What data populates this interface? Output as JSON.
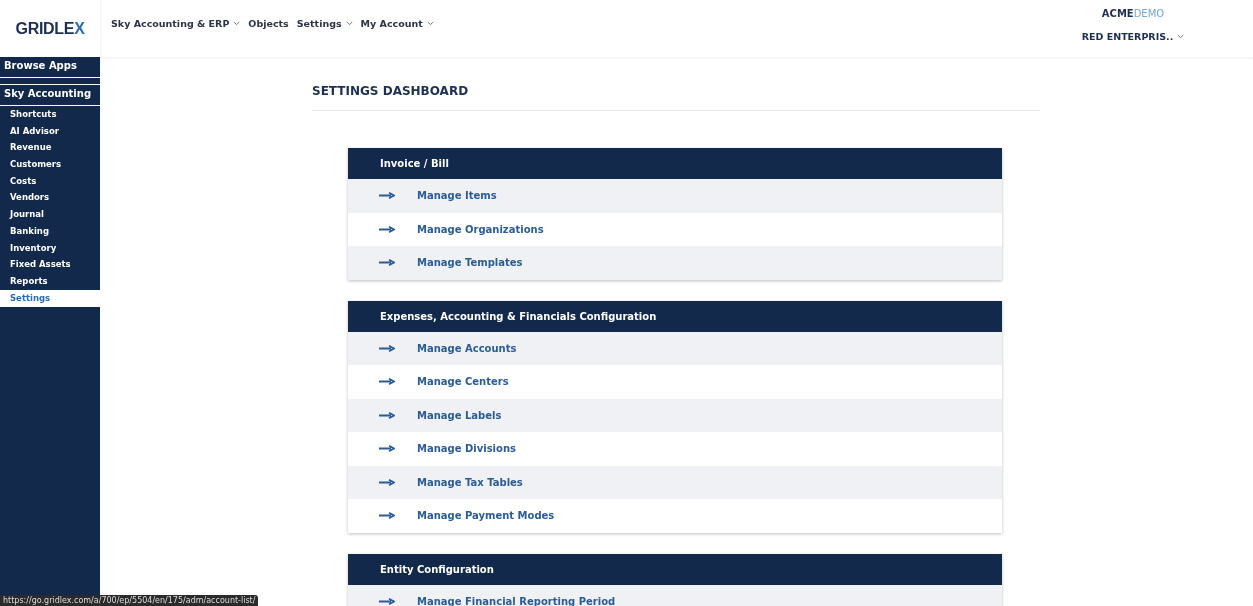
{
  "logo": {
    "main": "GRIDLE",
    "accent": "X"
  },
  "nav": [
    {
      "label": "Sky Accounting & ERP",
      "dropdown": true
    },
    {
      "label": "Objects",
      "dropdown": false
    },
    {
      "label": "Settings",
      "dropdown": true
    },
    {
      "label": "My Account",
      "dropdown": true
    }
  ],
  "brand": {
    "main": "ACME",
    "accent": "DEMO"
  },
  "company": {
    "label": "RED ENTERPRIS..",
    "dropdown": true
  },
  "sidebar": {
    "items": [
      {
        "label": "Browse Apps",
        "kind": "section",
        "selected": false
      },
      {
        "label": "Sky Accounting",
        "kind": "section",
        "selected": false
      },
      {
        "label": "Shortcuts",
        "kind": "item",
        "selected": false
      },
      {
        "label": "AI Advisor",
        "kind": "item",
        "selected": false
      },
      {
        "label": "Revenue",
        "kind": "item",
        "selected": false
      },
      {
        "label": "Customers",
        "kind": "item",
        "selected": false
      },
      {
        "label": "Costs",
        "kind": "item",
        "selected": false
      },
      {
        "label": "Vendors",
        "kind": "item",
        "selected": false
      },
      {
        "label": "Journal",
        "kind": "item",
        "selected": false
      },
      {
        "label": "Banking",
        "kind": "item",
        "selected": false
      },
      {
        "label": "Inventory",
        "kind": "item",
        "selected": false
      },
      {
        "label": "Fixed Assets",
        "kind": "item",
        "selected": false
      },
      {
        "label": "Reports",
        "kind": "item",
        "selected": false
      },
      {
        "label": "Settings",
        "kind": "item",
        "selected": true
      }
    ]
  },
  "page_title": "SETTINGS DASHBOARD",
  "cards": [
    {
      "title": "Invoice / Bill",
      "links": [
        "Manage Items",
        "Manage Organizations",
        "Manage Templates"
      ]
    },
    {
      "title": "Expenses, Accounting & Financials Configuration",
      "links": [
        "Manage Accounts",
        "Manage Centers",
        "Manage Labels",
        "Manage Divisions",
        "Manage Tax Tables",
        "Manage Payment Modes"
      ]
    },
    {
      "title": "Entity Configuration",
      "links": [
        "Manage Financial Reporting Period"
      ]
    }
  ],
  "status_bar": {
    "url": "https://go.gridlex.com/a/700/ep/5504/en/175/adm/account-list/"
  }
}
